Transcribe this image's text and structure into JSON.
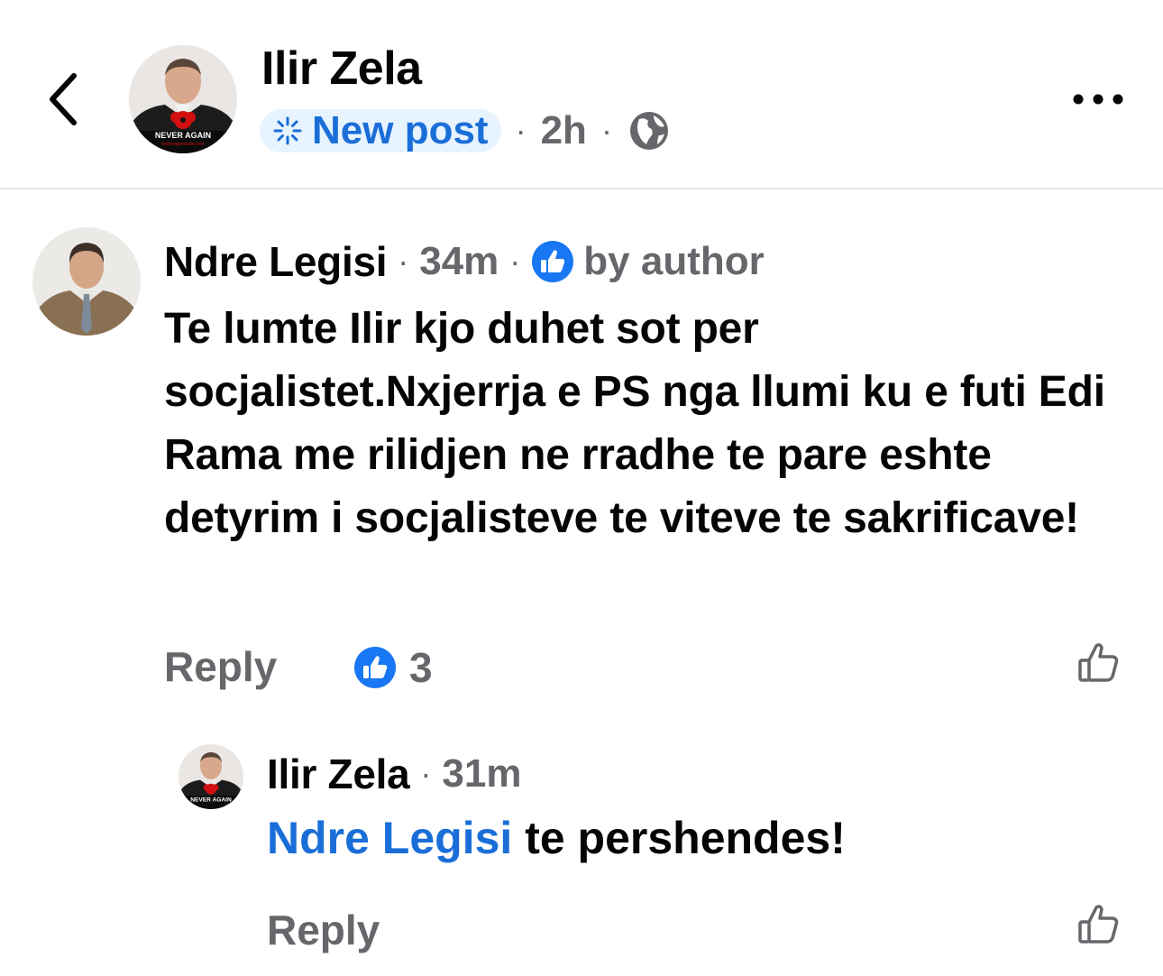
{
  "post": {
    "author": "Ilir Zela",
    "new_post_label": "New post",
    "time": "2h",
    "avatar_caption": "NEVER AGAIN",
    "avatar_sub_caption": "kosovogenocide.com"
  },
  "comment": {
    "author": "Ndre Legisi",
    "time": "34m",
    "liked_label": "by author",
    "text": "Te lumte Ilir kjo duhet sot per socjalistet.Nxjerrja e PS nga llumi ku e futi Edi Rama me rilidjen ne rradhe te pare eshte detyrim i socjalisteve te viteve te sakrificave!",
    "reply_label": "Reply",
    "reaction_count": "3"
  },
  "reply": {
    "author": "Ilir Zela",
    "time": "31m",
    "mention": "Ndre Legisi",
    "text": " te pershendes!",
    "reply_label": "Reply",
    "avatar_caption": "NEVER AGAIN"
  },
  "icons": {
    "back": "chevron-left-icon",
    "more": "more-horizontal-icon",
    "new_post": "sparkle-icon",
    "audience": "globe-icon",
    "like_badge": "thumbs-up-badge-icon",
    "like_button": "thumbs-up-outline-icon"
  },
  "colors": {
    "accent": "#1a6ed8",
    "pill_bg": "#e7f3ff",
    "secondary_text": "#65676b",
    "like_blue": "#1877f2",
    "poppy_red": "#d21010"
  }
}
